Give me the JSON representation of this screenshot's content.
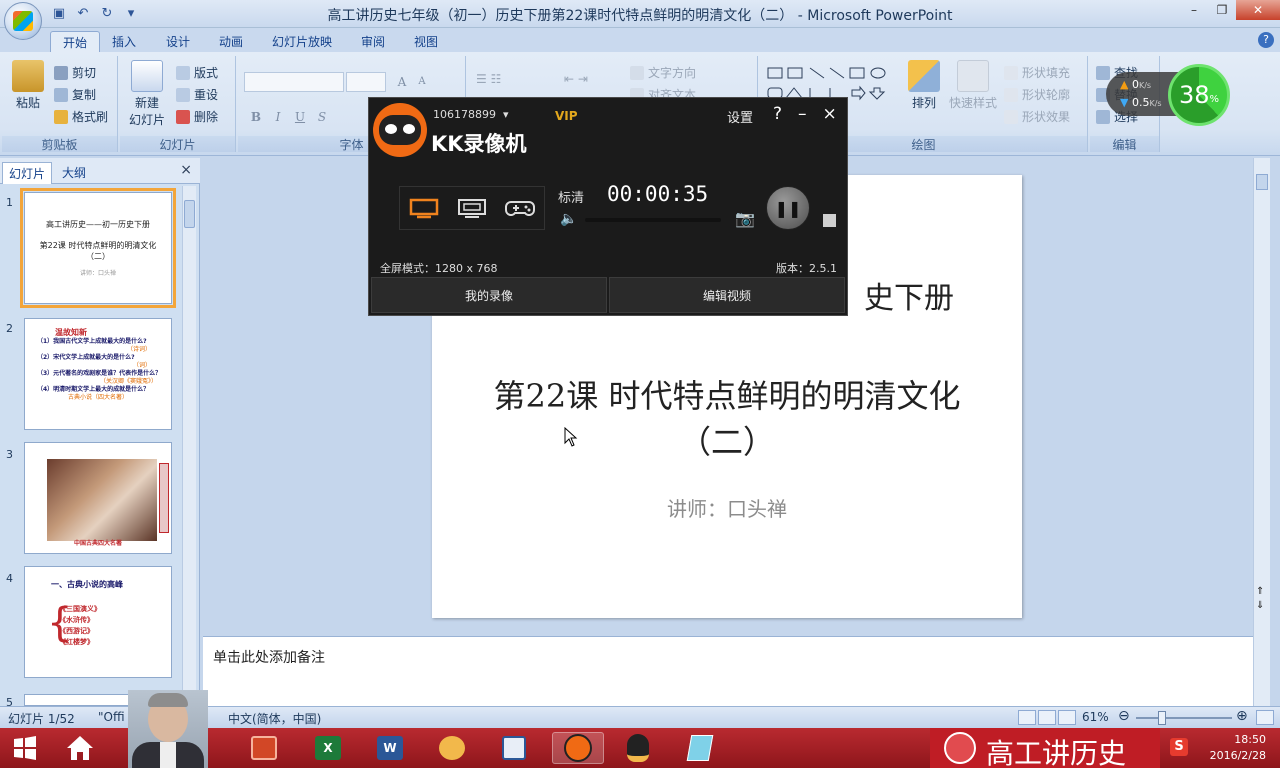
{
  "window": {
    "title": "高工讲历史七年级（初一）历史下册第22课时代特点鲜明的明清文化（二） - Microsoft PowerPoint"
  },
  "ribbon": {
    "tabs": [
      "开始",
      "插入",
      "设计",
      "动画",
      "幻灯片放映",
      "审阅",
      "视图"
    ],
    "active_tab": "开始",
    "clipboard": {
      "paste": "粘贴",
      "cut": "剪切",
      "copy": "复制",
      "format_painter": "格式刷",
      "label": "剪贴板"
    },
    "slides": {
      "new_slide_line1": "新建",
      "new_slide_line2": "幻灯片",
      "layout": "版式",
      "reset": "重设",
      "delete": "删除",
      "label": "幻灯片"
    },
    "font": {
      "label": "字体",
      "bold": "B",
      "italic": "I",
      "underline": "U",
      "shadow": "S",
      "grow": "A",
      "shrink": "A"
    },
    "paragraph": {
      "text_direction": "文字方向",
      "align_text": "对齐文本"
    },
    "drawing": {
      "arrange": "排列",
      "quick_styles": "快速样式",
      "shape_fill": "形状填充",
      "shape_outline": "形状轮廓",
      "shape_effects": "形状效果",
      "label": "绘图"
    },
    "editing": {
      "find": "查找",
      "replace": "替换",
      "select": "选择",
      "label": "编辑"
    }
  },
  "network_widget": {
    "upload": "0",
    "download": "0.5",
    "unit": "K/s",
    "percent": "38",
    "percent_sign": "%"
  },
  "left_pane": {
    "tabs": [
      "幻灯片",
      "大纲"
    ],
    "close": "×",
    "thumbnails": [
      {
        "num": "1",
        "lines": [
          "高工讲历史——初一历史下册",
          "第22课 时代特点鲜明的明清文化",
          "（二）",
          "讲师：口头禅"
        ]
      },
      {
        "num": "2",
        "lines": [
          "温故知新",
          "（1）我国古代文学上成就最大的是什么?",
          "（诗词）",
          "（2）宋代文学上成就最大的是什么?",
          "（词）",
          "（3）元代著名的戏剧家是谁？代表作是什么？",
          "（关汉卿《窦娥冤》）",
          "（4）明清时期文学上最大的成就是什么？",
          "古典小说（四大名著）"
        ]
      },
      {
        "num": "3",
        "lines": [
          "中国古典四大名著"
        ]
      },
      {
        "num": "4",
        "lines": [
          "一、古典小说的高峰",
          "《三国演义》",
          "《水浒传》",
          "《西游记》",
          "《红楼梦》"
        ]
      },
      {
        "num": "5",
        "lines": []
      }
    ]
  },
  "slide": {
    "title_line1": "史下册",
    "title_line2": "第22课 时代特点鲜明的明清文化",
    "title_line3": "（二）",
    "subtitle": "讲师：口头禅"
  },
  "notes": {
    "placeholder": "单击此处添加备注"
  },
  "status": {
    "slide_counter": "幻灯片 1/52",
    "theme": "\"Offi",
    "language": "中文(简体，中国)",
    "zoom": "61%"
  },
  "kk_recorder": {
    "account": "106178899",
    "vip": "VIP",
    "brand": "KK录像机",
    "settings": "设置",
    "help": "?",
    "minimize": "–",
    "close": "×",
    "quality": "标清",
    "timer": "00:00:35",
    "mode_text": "全屏模式：1280 x 768",
    "version": "版本：2.5.1",
    "my_recordings": "我的录像",
    "edit_video": "编辑视频"
  },
  "taskbar": {
    "banner": "高工讲历史",
    "time": "18:50",
    "date": "2016/2/28"
  },
  "colors": {
    "accent": "#1e395b",
    "kk_orange": "#f06a14",
    "taskbar_red": "#b92a30",
    "selected_thumb": "#f3a53a"
  }
}
